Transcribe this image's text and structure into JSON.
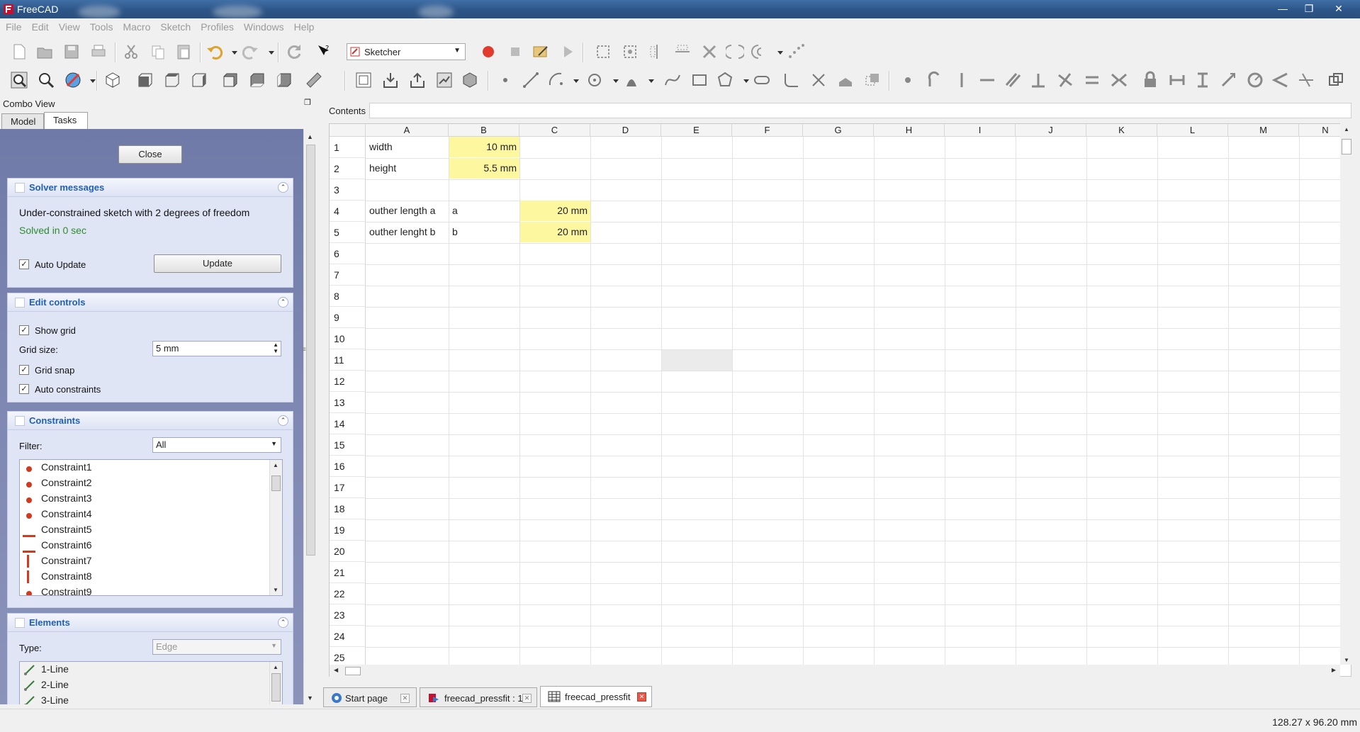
{
  "window": {
    "title": "FreeCAD"
  },
  "menu": [
    "File",
    "Edit",
    "View",
    "Tools",
    "Macro",
    "Sketch",
    "Profiles",
    "Windows",
    "Help"
  ],
  "toolbar": {
    "workbench": "Sketcher"
  },
  "combo_view": {
    "title": "Combo View",
    "tabs": [
      "Model",
      "Tasks"
    ],
    "active_tab": "Tasks",
    "close_label": "Close",
    "solver": {
      "title": "Solver messages",
      "message": "Under-constrained sketch with 2 degrees of freedom",
      "status": "Solved in 0 sec",
      "auto_update_label": "Auto Update",
      "auto_update_checked": true,
      "update_label": "Update",
      "status_color": "#2e8b2e"
    },
    "edit_controls": {
      "title": "Edit controls",
      "show_grid": "Show grid",
      "grid_size_label": "Grid size:",
      "grid_size_value": "5 mm",
      "grid_snap": "Grid snap",
      "auto_constraints": "Auto constraints"
    },
    "constraints": {
      "title": "Constraints",
      "filter_label": "Filter:",
      "filter_value": "All",
      "items": [
        {
          "name": "Constraint1",
          "icon": "coincident-dot-icon"
        },
        {
          "name": "Constraint2",
          "icon": "coincident-dot-icon"
        },
        {
          "name": "Constraint3",
          "icon": "coincident-dot-icon"
        },
        {
          "name": "Constraint4",
          "icon": "coincident-dot-icon"
        },
        {
          "name": "Constraint5",
          "icon": "horizontal-constraint-icon"
        },
        {
          "name": "Constraint6",
          "icon": "horizontal-constraint-icon"
        },
        {
          "name": "Constraint7",
          "icon": "vertical-constraint-icon"
        },
        {
          "name": "Constraint8",
          "icon": "vertical-constraint-icon"
        },
        {
          "name": "Constraint9",
          "icon": "coincident-dot-icon"
        }
      ]
    },
    "elements": {
      "title": "Elements",
      "type_label": "Type:",
      "type_value": "Edge",
      "items": [
        "1-Line",
        "2-Line",
        "3-Line"
      ]
    }
  },
  "spreadsheet": {
    "contents_label": "Contents",
    "columns": [
      "A",
      "B",
      "C",
      "D",
      "E",
      "F",
      "G",
      "H",
      "I",
      "J",
      "K",
      "L",
      "M",
      "N"
    ],
    "rows": [
      "1",
      "2",
      "3",
      "4",
      "5",
      "6",
      "7",
      "8",
      "9",
      "10",
      "11",
      "12",
      "13",
      "14",
      "15",
      "16",
      "17",
      "18",
      "19",
      "20",
      "21",
      "22",
      "23",
      "24",
      "25"
    ],
    "cells": {
      "A1": "width",
      "B1": "10 mm",
      "A2": "height",
      "B2": "5.5 mm",
      "A4": "outher length a",
      "B4": "a",
      "C4": "20 mm",
      "A5": "outher lenght b",
      "B5": "b",
      "C5": "20 mm"
    },
    "highlight_color": "#fdf8a0"
  },
  "doc_tabs": [
    {
      "label": "Start page",
      "icon": "start-page-icon"
    },
    {
      "label": "freecad_pressfit : 1",
      "icon": "freecad-doc-icon"
    },
    {
      "label": "freecad_pressfit",
      "icon": "spreadsheet-icon",
      "active": true
    }
  ],
  "status": {
    "dimensions": "128.27 x 96.20 mm"
  }
}
